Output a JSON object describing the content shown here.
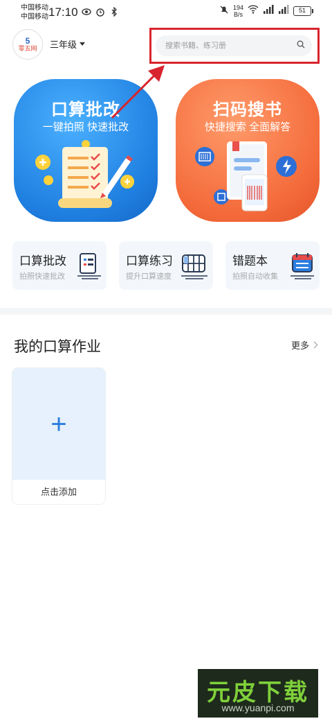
{
  "status_bar": {
    "carrier1": "中国移动",
    "carrier2": "中国移动",
    "time": "17:10",
    "net_speed_value": "194",
    "net_speed_unit": "B/s",
    "battery": "51"
  },
  "header": {
    "logo_num": "5",
    "logo_text": "零五网",
    "grade": "三年级",
    "search_placeholder": "搜索书籍、练习册"
  },
  "big_cards": [
    {
      "title": "口算批改",
      "subtitle": "一键拍照 快速批改"
    },
    {
      "title": "扫码搜书",
      "subtitle": "快捷搜索 全面解答"
    }
  ],
  "small_cards": [
    {
      "title": "口算批改",
      "subtitle": "拍照快速批改"
    },
    {
      "title": "口算练习",
      "subtitle": "提升口算速度"
    },
    {
      "title": "错题本",
      "subtitle": "拍照自动收集"
    }
  ],
  "section": {
    "title": "我的口算作业",
    "more": "更多"
  },
  "add_card": {
    "plus": "+",
    "label": "点击添加"
  },
  "watermark": {
    "brand": "元皮下载",
    "url": "www.yuanpi.com"
  },
  "colors": {
    "accent_blue": "#2b7de0",
    "accent_orange": "#f46a3a",
    "highlight_red": "#d8242e"
  }
}
